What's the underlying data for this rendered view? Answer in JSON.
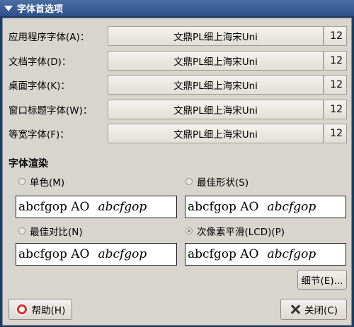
{
  "window": {
    "title": "字体首选项"
  },
  "fonts": [
    {
      "label": "应用程序字体(A)：",
      "font": "文鼎PL细上海宋Uni",
      "size": "12"
    },
    {
      "label": "文档字体(D)：",
      "font": "文鼎PL细上海宋Uni",
      "size": "12"
    },
    {
      "label": "桌面字体(K)：",
      "font": "文鼎PL细上海宋Uni",
      "size": "12"
    },
    {
      "label": "窗口标题字体(W)：",
      "font": "文鼎PL细上海宋Uni",
      "size": "12"
    },
    {
      "label": "等宽字体(F)：",
      "font": "文鼎PL细上海宋Uni",
      "size": "12"
    }
  ],
  "rendering": {
    "title": "字体渲染",
    "options": [
      {
        "label": "单色(M)",
        "selected": false
      },
      {
        "label": "最佳形状(S)",
        "selected": false
      },
      {
        "label": "最佳对比(N)",
        "selected": false
      },
      {
        "label": "次像素平滑(LCD)(P)",
        "selected": true
      }
    ],
    "sample_text": "abcfgop AO",
    "sample_italic": "abcfgop"
  },
  "buttons": {
    "details": "细节(E)...",
    "help": "帮助(H)",
    "close": "关闭(C)"
  }
}
